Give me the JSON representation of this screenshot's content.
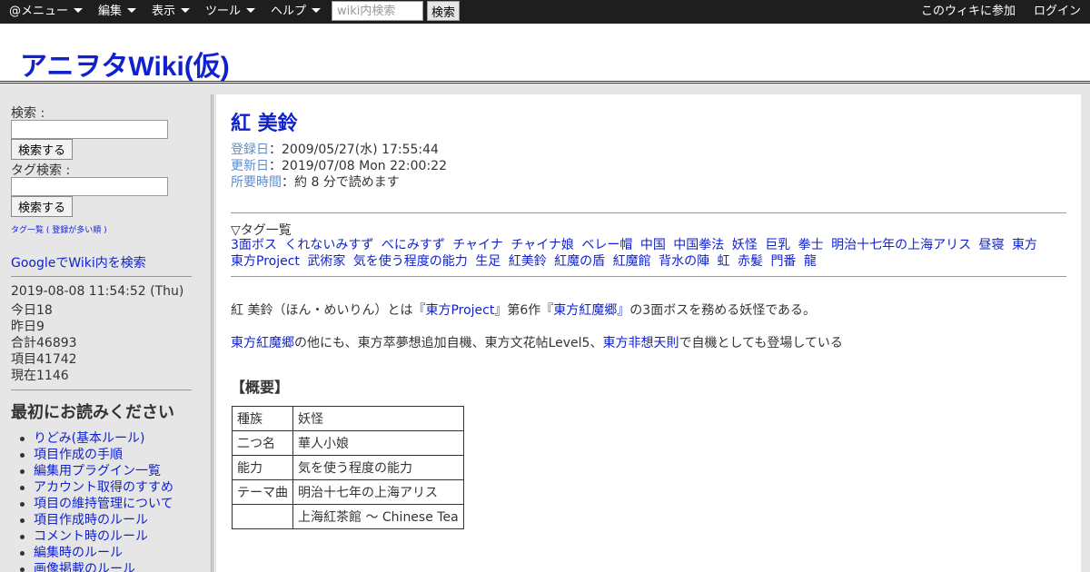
{
  "topbar": {
    "menus": [
      {
        "label": "@メニュー"
      },
      {
        "label": "編集"
      },
      {
        "label": "表示"
      },
      {
        "label": "ツール"
      },
      {
        "label": "ヘルプ"
      }
    ],
    "search_placeholder": "wiki内検索",
    "search_button": "検索",
    "join": "このウィキに参加",
    "login": "ログイン"
  },
  "header": {
    "site_title": "アニヲタWiki(仮)"
  },
  "sidebar": {
    "search_label": "検索 :",
    "search_button": "検索する",
    "tag_search_label": "タグ検索 :",
    "tag_search_button": "検索する",
    "tag_list_link": "タグ一覧 ( 登録が多い順 )",
    "google_search": "GoogleでWiki内を検索",
    "counter": {
      "datetime": "2019-08-08 11:54:52 (Thu)",
      "today": "今日18",
      "yesterday": "昨日9",
      "total": "合計46893",
      "items": "項目41742",
      "now": "現在1146"
    },
    "read_first_heading": "最初にお読みください",
    "read_first_links": [
      "りどみ(基本ルール)",
      "項目作成の手順",
      "編集用プラグイン一覧",
      "アカウント取得のすすめ",
      "項目の維持管理について",
      "項目作成時のルール",
      "コメント時のルール",
      "編集時のルール",
      "画像掲載のルール"
    ]
  },
  "page": {
    "title": "紅 美鈴",
    "registered_label": "登録日",
    "registered_value": "：2009/05/27(水) 17:55:44",
    "updated_label": "更新日",
    "updated_value": "：2019/07/08 Mon 22:00:22",
    "read_time_label": "所要時間",
    "read_time_value": "：約 8 分で読めます",
    "tags_heading": "▽タグ一覧",
    "tags": [
      "3面ボス",
      "くれないみすず",
      "べにみすず",
      "チャイナ",
      "チャイナ娘",
      "ベレー帽",
      "中国",
      "中国拳法",
      "妖怪",
      "巨乳",
      "拳士",
      "明治十七年の上海アリス",
      "昼寝",
      "東方",
      "東方Project",
      "武術家",
      "気を使う程度の能力",
      "生足",
      "紅美鈴",
      "紅魔の盾",
      "紅魔館",
      "背水の陣",
      "虹",
      "赤髪",
      "門番",
      "龍"
    ],
    "intro": {
      "p1_a": "紅 美鈴（ほん・めいりん）とは",
      "p1_link1": "『東方Project』",
      "p1_b": "第6作",
      "p1_link2": "『東方紅魔郷』",
      "p1_c": "の3面ボスを務める妖怪である。",
      "p2_link1": "東方紅魔郷",
      "p2_a": "の他にも、東方萃夢想追加自機、東方文花帖Level5、",
      "p2_link2": "東方非想天則",
      "p2_b": "で自機としても登場している"
    },
    "overview_heading": "【概要】",
    "overview_table": [
      {
        "k": "種族",
        "v": "妖怪"
      },
      {
        "k": "二つ名",
        "v": "華人小娘"
      },
      {
        "k": "能力",
        "v": "気を使う程度の能力"
      },
      {
        "k": "テーマ曲",
        "v": "明治十七年の上海アリス"
      },
      {
        "k": "",
        "v": "上海紅茶館 ～ Chinese Tea"
      }
    ]
  }
}
